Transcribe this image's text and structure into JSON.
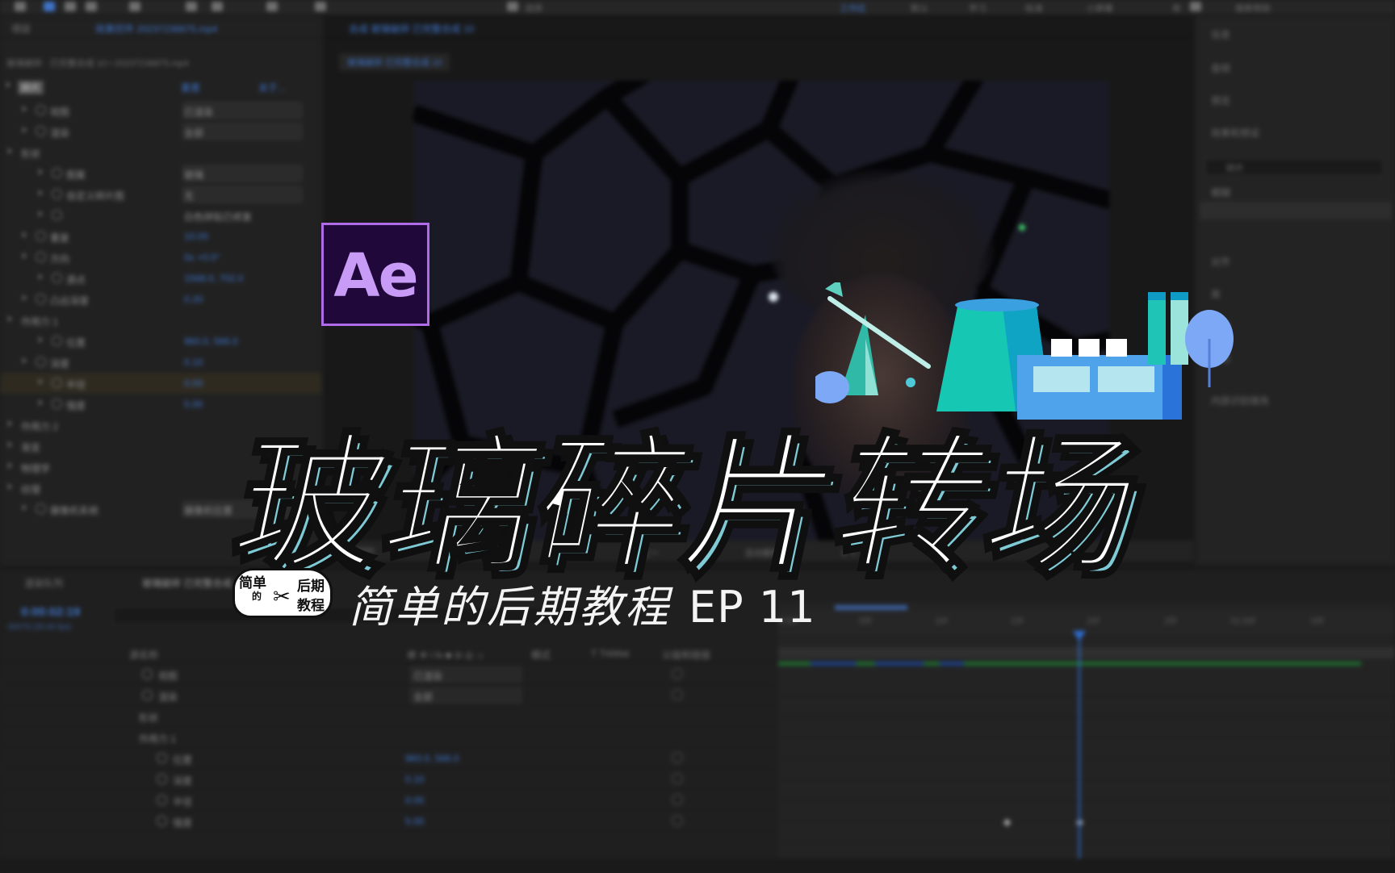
{
  "toolbar": {
    "items": [
      "选择",
      "工作区",
      "默认",
      "学习",
      "标准",
      "小屏幕",
      "库"
    ],
    "search_placeholder": "搜索帮助"
  },
  "project_panel": {
    "tabs": [
      "项目",
      "效果控件 20237238875.mp4"
    ],
    "breadcrumb": "玻璃破碎 · 已完整合成 10 • 20237238875.mp4",
    "fx_label": "碎片",
    "reset_label": "重置",
    "about_label": "关于...",
    "rows": [
      {
        "name": "视图",
        "value": "已渲染"
      },
      {
        "name": "渲染",
        "value": "全部"
      },
      {
        "name": "形状",
        "value": ""
      },
      {
        "name": "图案",
        "value": "玻璃"
      },
      {
        "name": "自定义碎片图",
        "value": "无"
      },
      {
        "name": "",
        "value": "白色拼贴已修复"
      },
      {
        "name": "重复",
        "value": "10.00"
      },
      {
        "name": "方向",
        "value": "0x +0.0°"
      },
      {
        "name": "源点",
        "value": "1568.0, 702.0"
      },
      {
        "name": "凸出深度",
        "value": "0.20"
      },
      {
        "name": "作用力 1",
        "value": ""
      },
      {
        "name": "位置",
        "value": "960.0, 566.0"
      },
      {
        "name": "深度",
        "value": "0.10"
      },
      {
        "name": "半径",
        "value": "0.00"
      },
      {
        "name": "强度",
        "value": "5.00"
      },
      {
        "name": "作用力 2",
        "value": ""
      },
      {
        "name": "渐变",
        "value": ""
      },
      {
        "name": "物理学",
        "value": ""
      },
      {
        "name": "纹理",
        "value": ""
      },
      {
        "name": "摄像机系统",
        "value": "摄像机位置"
      }
    ]
  },
  "composition_panel": {
    "tab": "合成 玻璃破碎 已完整合成 10",
    "sub_tab": "玻璃破碎 已完整合成 10",
    "viewer_bar": [
      "50%",
      "0:00:02:19",
      "二分之一",
      "活动摄像机",
      "1 个...",
      "+0.0"
    ]
  },
  "right_panel": {
    "items": [
      "信息",
      "音频",
      "预览",
      "效果和预设",
      "碎片",
      "模糊",
      "对齐",
      "库",
      "段落",
      "字符",
      "内容识别填充"
    ]
  },
  "timeline": {
    "tabs": [
      "渲染队列",
      "玻璃破碎 已完整合成 10"
    ],
    "current_time": "0:00:02:19",
    "frame_info": "00079 (30.00 fps)",
    "columns": [
      "源名称",
      "单 ✲ \\ fx ■ ⊘ ◎ ☼",
      "模式",
      "T TrkMat",
      "父级和链接"
    ],
    "ruler": [
      "0:00f",
      "05f",
      "10f",
      "15f",
      "20f",
      "25f",
      "01:00f",
      "05f"
    ],
    "rows": [
      {
        "name": "视图",
        "value": "已渲染"
      },
      {
        "name": "渲染",
        "value": "全部"
      },
      {
        "name": "形状",
        "value": ""
      },
      {
        "name": "作用力 1",
        "value": ""
      },
      {
        "name": "位置",
        "value": "960.0, 566.0"
      },
      {
        "name": "深度",
        "value": "0.10"
      },
      {
        "name": "半径",
        "value": "0.00"
      },
      {
        "name": "强度",
        "value": "5.00"
      }
    ]
  },
  "overlay": {
    "app_logo": "Ae",
    "title": "玻璃碎片转场",
    "badge_top": "简单",
    "badge_mid": "的",
    "badge_right": "后期",
    "badge_bottom": "教程",
    "subtitle": "简单的后期教程",
    "episode": "EP 11"
  },
  "colors": {
    "title_fill": "#ffffff",
    "title_shadow": "#7ecbd6",
    "ae_border": "#b06be8",
    "ae_bg": "#20093a",
    "ae_accent_blue": "#3f74c9"
  }
}
